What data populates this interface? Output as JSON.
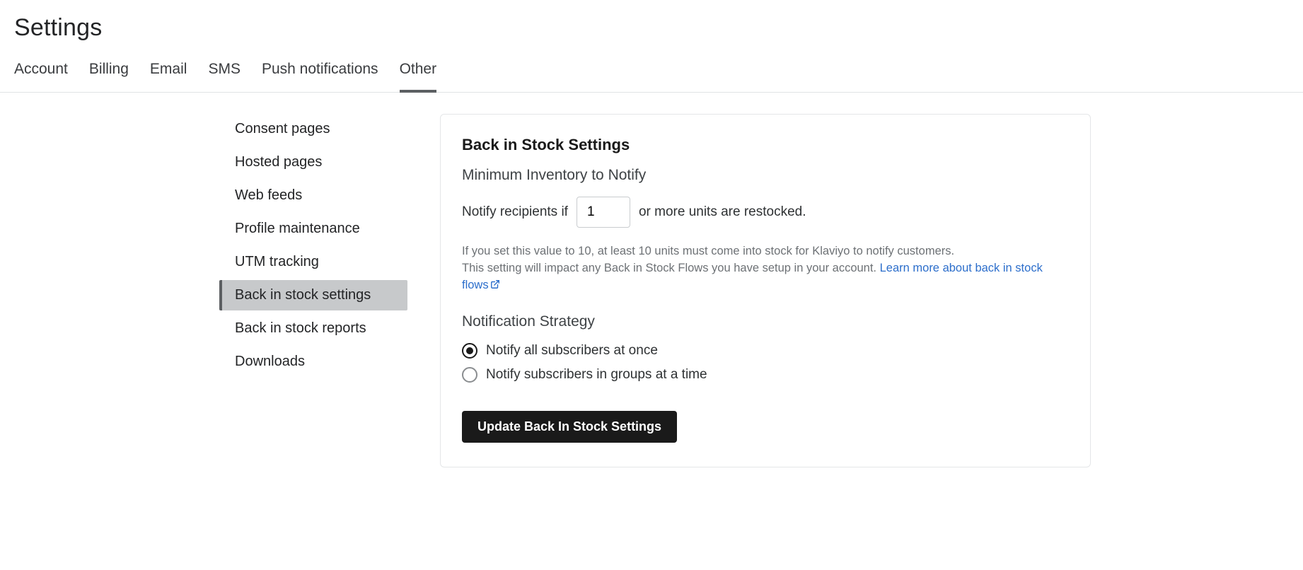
{
  "page_title": "Settings",
  "tabs": [
    {
      "label": "Account",
      "active": false
    },
    {
      "label": "Billing",
      "active": false
    },
    {
      "label": "Email",
      "active": false
    },
    {
      "label": "SMS",
      "active": false
    },
    {
      "label": "Push notifications",
      "active": false
    },
    {
      "label": "Other",
      "active": true
    }
  ],
  "sidebar": {
    "items": [
      {
        "label": "Consent pages",
        "active": false
      },
      {
        "label": "Hosted pages",
        "active": false
      },
      {
        "label": "Web feeds",
        "active": false
      },
      {
        "label": "Profile maintenance",
        "active": false
      },
      {
        "label": "UTM tracking",
        "active": false
      },
      {
        "label": "Back in stock settings",
        "active": true
      },
      {
        "label": "Back in stock reports",
        "active": false
      },
      {
        "label": "Downloads",
        "active": false
      }
    ]
  },
  "panel": {
    "title": "Back in Stock Settings",
    "min_inventory": {
      "heading": "Minimum Inventory to Notify",
      "prefix": "Notify recipients if",
      "value": "1",
      "suffix": "or more units are restocked.",
      "help_line1": "If you set this value to 10, at least 10 units must come into stock for Klaviyo to notify customers.",
      "help_line2": "This setting will impact any Back in Stock Flows you have setup in your account. ",
      "help_link_label": "Learn more about back in stock flows"
    },
    "strategy": {
      "heading": "Notification Strategy",
      "options": [
        {
          "label": "Notify all subscribers at once",
          "selected": true
        },
        {
          "label": "Notify subscribers in groups at a time",
          "selected": false
        }
      ]
    },
    "submit_label": "Update Back In Stock Settings"
  }
}
